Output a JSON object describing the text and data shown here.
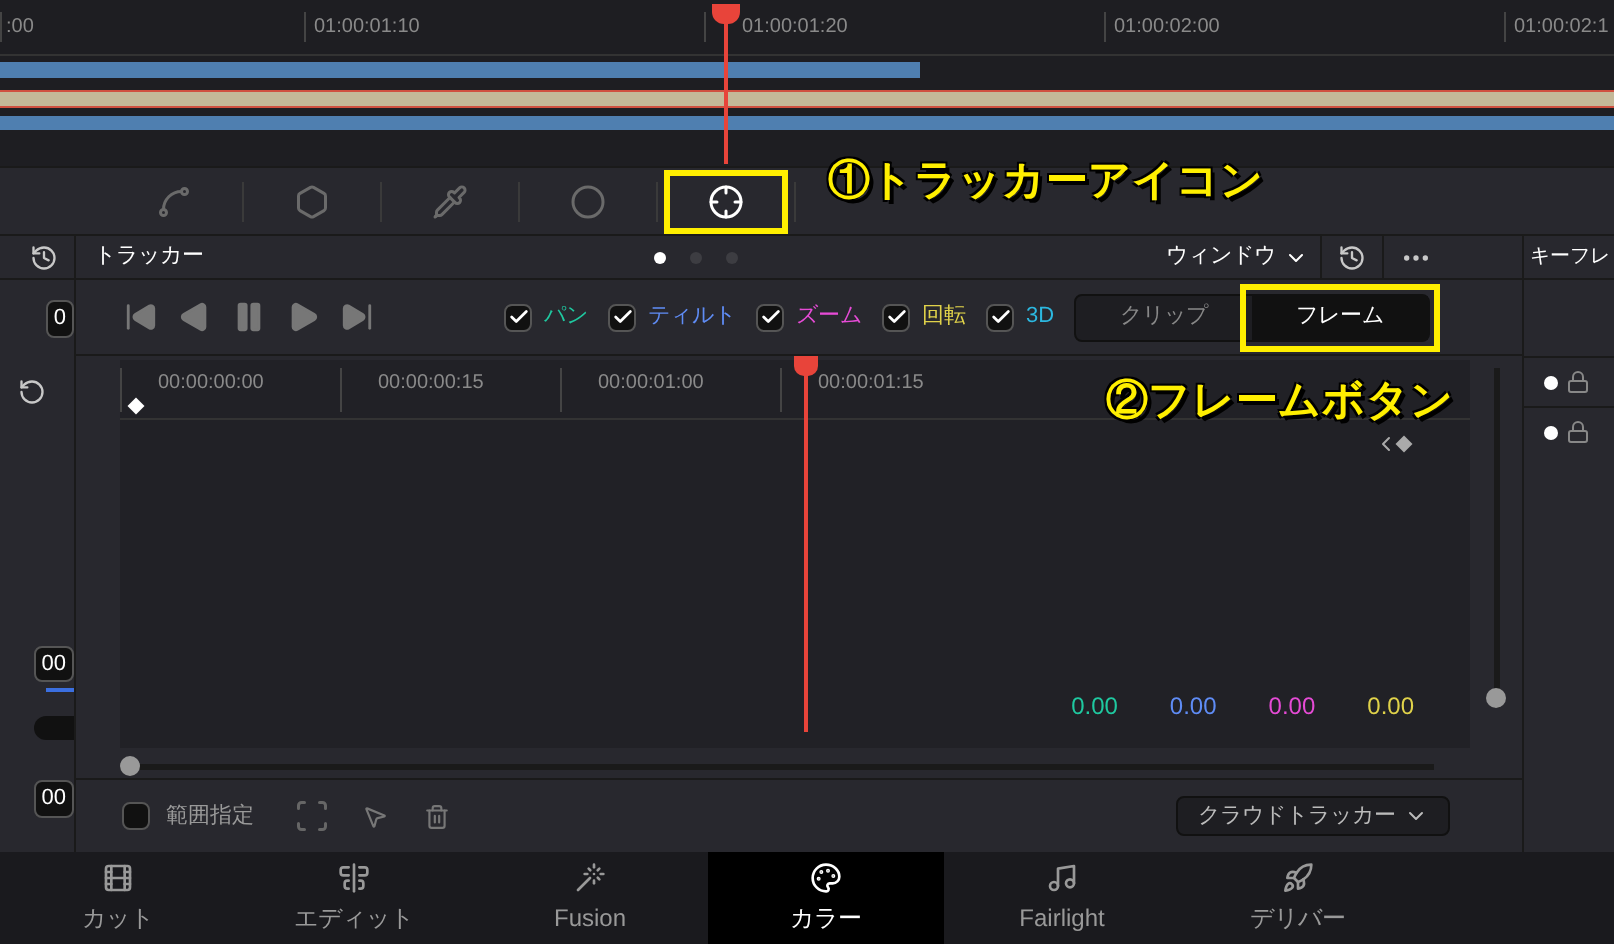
{
  "timeline": {
    "ruler": [
      ":00",
      "01:00:01:10",
      "01:00:01:20",
      "01:00:02:00",
      "01:00:02:1"
    ]
  },
  "palette_tools": [
    {
      "kind": "curves",
      "selected": false
    },
    {
      "kind": "warper",
      "selected": false
    },
    {
      "kind": "qualifier",
      "selected": false
    },
    {
      "kind": "window",
      "selected": false
    },
    {
      "kind": "tracker",
      "selected": true
    }
  ],
  "left_column": {
    "fields": [
      "0",
      "00",
      "00"
    ]
  },
  "tracker": {
    "title": "トラッカー",
    "page_dots": [
      {
        "selected": true
      },
      {
        "selected": false
      },
      {
        "selected": false
      }
    ],
    "window_menu": "ウィンドウ",
    "options": [
      {
        "label": "パン",
        "checked": true,
        "color": "#1fc9a0"
      },
      {
        "label": "ティルト",
        "checked": true,
        "color": "#5f8cf5"
      },
      {
        "label": "ズーム",
        "checked": true,
        "color": "#e64bd6"
      },
      {
        "label": "回転",
        "checked": true,
        "color": "#e0d24a"
      },
      {
        "label": "3D",
        "checked": true,
        "color": "#2cb8e0"
      }
    ],
    "modes": [
      {
        "label": "クリップ",
        "selected": false
      },
      {
        "label": "フレーム",
        "selected": true
      }
    ],
    "ruler": [
      "00:00:00:00",
      "00:00:00:15",
      "00:00:01:00",
      "00:00:01:15"
    ],
    "readouts": [
      {
        "text": "0.00",
        "color": "#1fc9a0"
      },
      {
        "text": "0.00",
        "color": "#5f8cf5"
      },
      {
        "text": "0.00",
        "color": "#e64bd6"
      },
      {
        "text": "0.00",
        "color": "#e0d24a"
      }
    ],
    "zoom_slider": {
      "level": 0
    },
    "scroll": {
      "level": 0
    },
    "range": {
      "label": "範囲指定",
      "checked": false
    },
    "tracker_menu": "クラウドトラッカー"
  },
  "keyframes": {
    "title": "キーフレ"
  },
  "annotations": [
    "①トラッカーアイコン",
    "②フレームボタン"
  ],
  "pages": [
    {
      "kind": "cut",
      "label": "カット",
      "selected": false
    },
    {
      "kind": "edit",
      "label": "エディット",
      "selected": false
    },
    {
      "kind": "fusion",
      "label": "Fusion",
      "selected": false
    },
    {
      "kind": "color",
      "label": "カラー",
      "selected": true
    },
    {
      "kind": "audio",
      "label": "Fairlight",
      "selected": false
    },
    {
      "kind": "deliver",
      "label": "デリバー",
      "selected": false
    }
  ]
}
